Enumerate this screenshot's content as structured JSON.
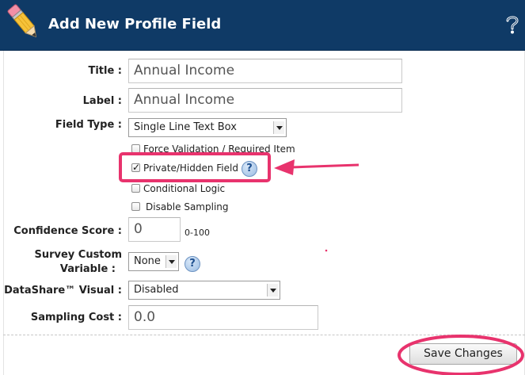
{
  "header": {
    "title": "Add New Profile Field",
    "help_glyph": "?",
    "background_color": "#0f3a66",
    "pencil_icon": "pencil-icon",
    "help_icon": "help-question-icon"
  },
  "form": {
    "title_label": "Title :",
    "title_value": "Annual Income",
    "label_label": "Label :",
    "label_value": "Annual Income",
    "field_type_label": "Field Type :",
    "field_type_value": "Single Line Text Box",
    "options": [
      {
        "label": "Force Validation / Required Item",
        "checked": false
      },
      {
        "label": "Private/Hidden Field",
        "checked": true
      },
      {
        "label": "Conditional Logic",
        "checked": false
      },
      {
        "label": "Disable Sampling",
        "checked": false
      }
    ],
    "confidence_label": "Confidence Score :",
    "confidence_value": "0",
    "confidence_range": "0-100",
    "survey_var_label_line1": "Survey Custom",
    "survey_var_label_line2": "Variable :",
    "survey_var_value": "None",
    "datashare_label": "DataShare™ Visual :",
    "datashare_value": "Disabled",
    "sampling_cost_label": "Sampling Cost :",
    "sampling_cost_value": "0.0",
    "help_glyph": "?"
  },
  "actions": {
    "save_label": "Save Changes"
  },
  "annotations": {
    "highlight_color": "#e8336d"
  }
}
